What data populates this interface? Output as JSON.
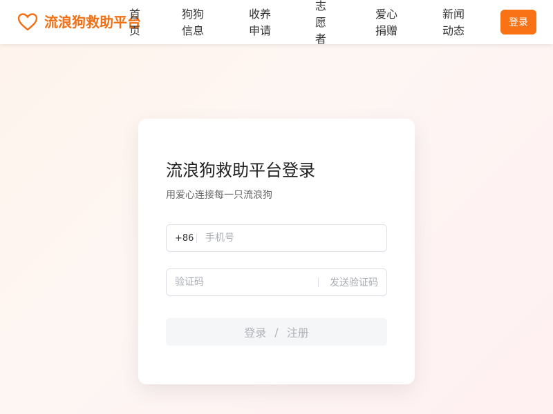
{
  "brand": {
    "icon": "heart-icon",
    "name": "流浪狗救助平台",
    "color": "#f07016"
  },
  "nav": {
    "home": [
      "首",
      "页"
    ],
    "dogs": [
      "狗狗",
      "信息"
    ],
    "adopt": [
      "收养",
      "申请"
    ],
    "volunteer": [
      "志",
      "愿",
      "者"
    ],
    "donate": [
      "爱心",
      "捐赠"
    ],
    "news": [
      "新闻",
      "动态"
    ]
  },
  "header": {
    "login_label": "登录",
    "accent_color": "#f97316"
  },
  "login_card": {
    "title": "流浪狗救助平台登录",
    "subtitle": "用爱心连接每一只流浪狗",
    "phone": {
      "prefix": "+86",
      "placeholder": "手机号",
      "value": ""
    },
    "code": {
      "placeholder": "验证码",
      "value": "",
      "send_label": "发送验证码"
    },
    "submit": {
      "login_label": "登录",
      "separator": "/",
      "register_label": "注册"
    }
  }
}
